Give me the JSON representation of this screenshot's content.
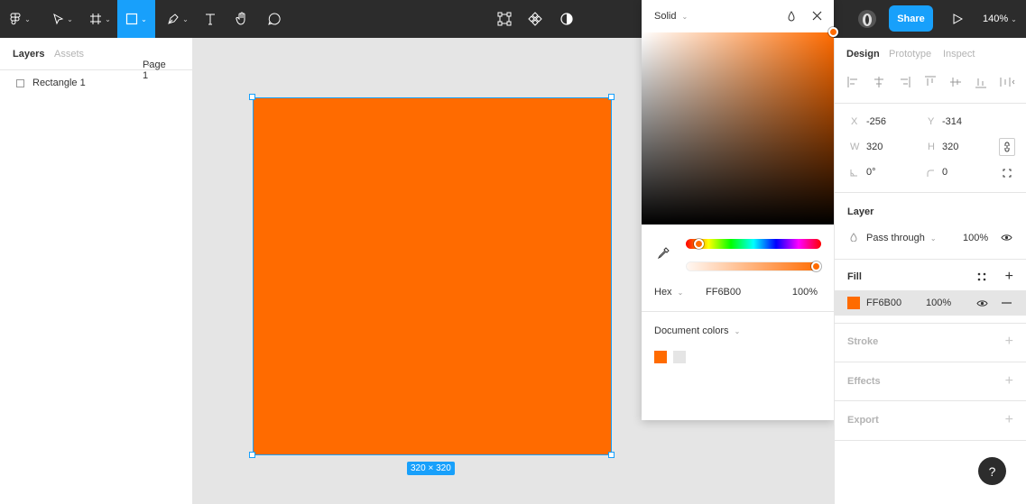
{
  "toolbar": {
    "share_label": "Share",
    "zoom_label": "140%"
  },
  "left_panel": {
    "tabs": [
      "Layers",
      "Assets"
    ],
    "page_label": "Page 1",
    "layers": [
      {
        "name": "Rectangle 1"
      }
    ]
  },
  "canvas": {
    "size_label": "320 × 320",
    "fill_color": "#FF6B00"
  },
  "color_picker": {
    "mode_label": "Solid",
    "hex_label": "Hex",
    "hex_value": "FF6B00",
    "opacity": "100%",
    "doc_colors_label": "Document colors",
    "doc_swatches": [
      "#FF6B00",
      "#E5E5E5"
    ]
  },
  "design_panel": {
    "tabs": [
      "Design",
      "Prototype",
      "Inspect"
    ],
    "x_label": "X",
    "x_value": "-256",
    "y_label": "Y",
    "y_value": "-314",
    "w_label": "W",
    "w_value": "320",
    "h_label": "H",
    "h_value": "320",
    "rotation": "0°",
    "radius": "0",
    "layer_title": "Layer",
    "blend_mode": "Pass through",
    "layer_opacity": "100%",
    "fill_title": "Fill",
    "fill_hex": "FF6B00",
    "fill_opacity": "100%",
    "stroke_title": "Stroke",
    "effects_title": "Effects",
    "export_title": "Export"
  },
  "help_label": "?"
}
